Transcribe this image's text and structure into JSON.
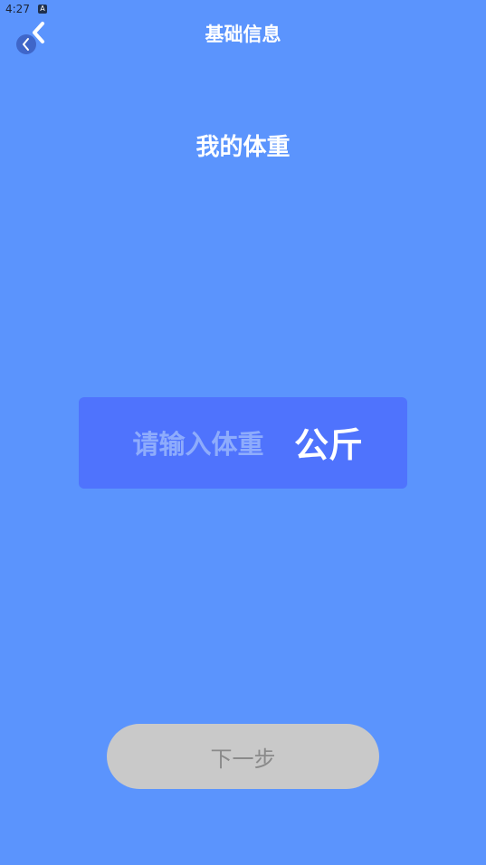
{
  "status_bar": {
    "time": "4:27",
    "notification_icon_glyph": "A"
  },
  "header": {
    "title": "基础信息",
    "back_icon": "chevron-left-icon"
  },
  "page": {
    "heading": "我的体重"
  },
  "weight": {
    "input_value": "",
    "placeholder": "请输入体重",
    "unit": "公斤"
  },
  "actions": {
    "next_label": "下一步"
  },
  "colors": {
    "background": "#5b94fd",
    "input_box": "#4f73fd",
    "placeholder": "#8eacfc",
    "button_disabled": "#c9c9c9",
    "button_text_disabled": "#8a8a8a"
  }
}
